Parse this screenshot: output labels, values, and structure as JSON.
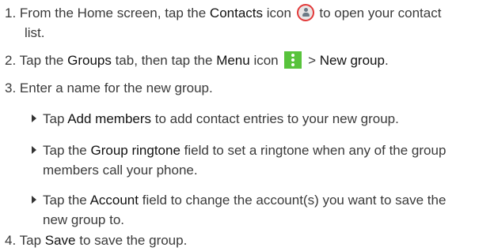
{
  "steps": [
    {
      "number": "1.",
      "parts": [
        "From the Home screen, tap the ",
        "Contacts",
        " icon ",
        " to open your contact",
        "list."
      ]
    },
    {
      "number": "2.",
      "parts": [
        "Tap the ",
        "Groups",
        " tab, then tap the ",
        "Menu",
        " icon ",
        " > ",
        "New group",
        "."
      ]
    },
    {
      "number": "3.",
      "text": "Enter a name for the new group.",
      "bullets": [
        {
          "bold": "Add members",
          "pre": "Tap ",
          "post": " to add contact entries to your new group."
        },
        {
          "pre": "Tap the ",
          "bold": "Group ringtone",
          "post_line1": " field to set a ringtone when any of the group",
          "post_line2": "members call your phone."
        },
        {
          "pre": "Tap the ",
          "bold": "Account",
          "post_line1": " field to change the account(s) you want to save the",
          "post_line2": "new group to."
        }
      ]
    },
    {
      "number": "4.",
      "parts": [
        "Tap ",
        "Save",
        " to save the group."
      ]
    }
  ],
  "icons": {
    "contacts": "contacts-icon",
    "menu": "menu-icon",
    "bullet": "triangle-bullet-icon"
  },
  "colors": {
    "contacts_icon_ring": "#e23a3a",
    "menu_icon_bg": "#58c33c"
  }
}
